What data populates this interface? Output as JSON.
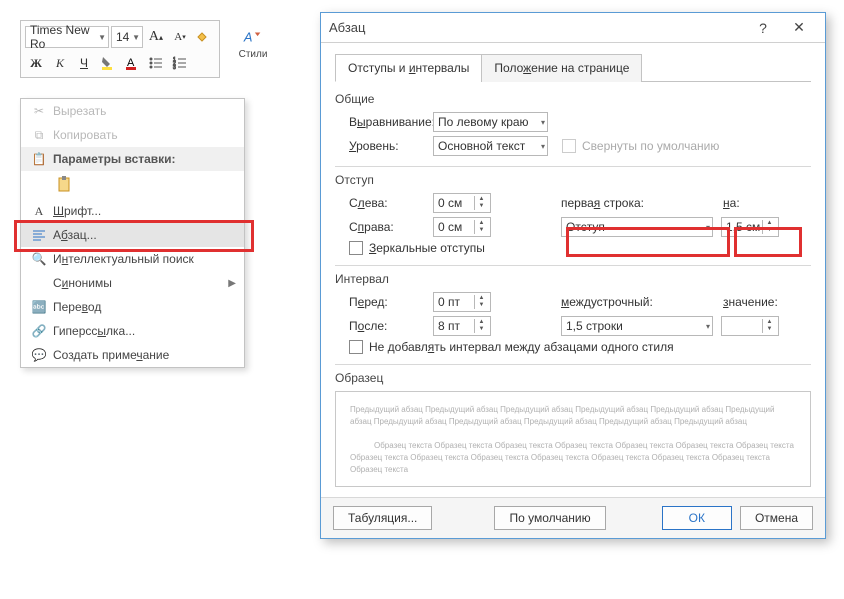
{
  "ribbon": {
    "font_name": "Times New Ro",
    "font_size": "14",
    "styles_label": "Стили",
    "bold": "Ж",
    "italic": "К",
    "underline": "Ч"
  },
  "context_menu": {
    "cut": "Вырезать",
    "copy": "Копировать",
    "paste_header": "Параметры вставки:",
    "font": "Шрифт...",
    "paragraph": "Абзац...",
    "smart_lookup": "Интеллектуальный поиск",
    "synonyms": "Синонимы",
    "translate": "Перевод",
    "hyperlink": "Гиперссылка...",
    "comment": "Создать примечание"
  },
  "dialog": {
    "title": "Абзац",
    "tabs": {
      "indents": "Отступы и интервалы",
      "position": "Положение на странице"
    },
    "general": {
      "title": "Общие",
      "align_label": "Выравнивание:",
      "align_value": "По левому краю",
      "level_label": "Уровень:",
      "level_value": "Основной текст",
      "collapsed": "Свернуты по умолчанию"
    },
    "indent": {
      "title": "Отступ",
      "left_label": "Слева:",
      "left_value": "0 см",
      "right_label": "Справа:",
      "right_value": "0 см",
      "first_label": "первая строка:",
      "first_value": "Отступ",
      "na_label": "на:",
      "na_value": "1,5 см",
      "mirror": "Зеркальные отступы"
    },
    "spacing": {
      "title": "Интервал",
      "before_label": "Перед:",
      "before_value": "0 пт",
      "after_label": "После:",
      "after_value": "8 пт",
      "line_label": "междустрочный:",
      "line_value": "1,5 строки",
      "val_label": "значение:",
      "val_value": "",
      "no_space": "Не добавлять интервал между абзацами одного стиля"
    },
    "preview": {
      "title": "Образец",
      "prev_para": "Предыдущий абзац Предыдущий абзац Предыдущий абзац Предыдущий абзац Предыдущий абзац Предыдущий абзац Предыдущий абзац Предыдущий абзац Предыдущий абзац Предыдущий абзац Предыдущий абзац",
      "sample": "Образец текста Образец текста Образец текста Образец текста Образец текста Образец текста Образец текста Образец текста Образец текста Образец текста Образец текста Образец текста Образец текста Образец текста Образец текста"
    },
    "buttons": {
      "tabs": "Табуляция...",
      "default": "По умолчанию",
      "ok": "ОК",
      "cancel": "Отмена"
    }
  }
}
